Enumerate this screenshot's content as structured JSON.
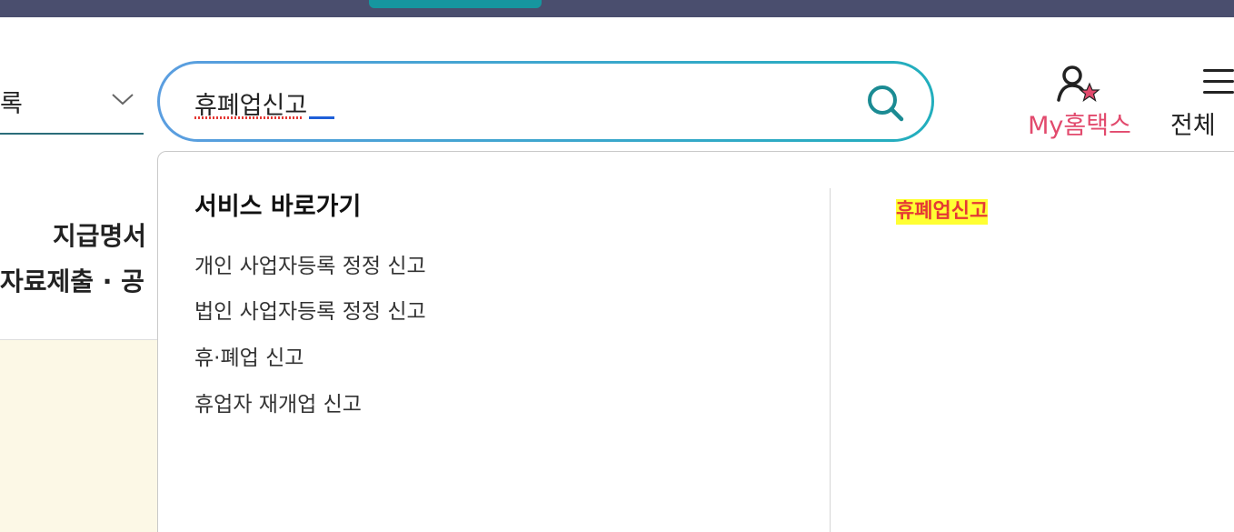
{
  "search": {
    "category_label": "록",
    "query": "휴폐업신고"
  },
  "header": {
    "my_hometax_label": "My홈택스",
    "all_menu_label": "전체"
  },
  "background": {
    "line1": "지급명서",
    "line2": "자료제출 · 공"
  },
  "dropdown": {
    "heading": "서비스 바로가기",
    "items": [
      {
        "label": "개인 사업자등록 정정 신고"
      },
      {
        "label": "법인 사업자등록 정정 신고"
      },
      {
        "label": "휴·폐업 신고"
      },
      {
        "label": "휴업자 재개업 신고"
      }
    ],
    "keyword_highlight": "휴폐업신고"
  },
  "colors": {
    "topbar": "#4a4e6e",
    "topbar_tab": "#16969f",
    "search_border_start": "#5b9ee0",
    "search_border_end": "#22aebd",
    "my_hometax": "#e24a6d",
    "highlight_bg": "#ffff33",
    "highlight_text": "#e53935"
  },
  "icons": {
    "search": "search-icon",
    "user_star": "user-star-icon",
    "hamburger": "hamburger-menu-icon",
    "chevron": "chevron-down-icon"
  }
}
